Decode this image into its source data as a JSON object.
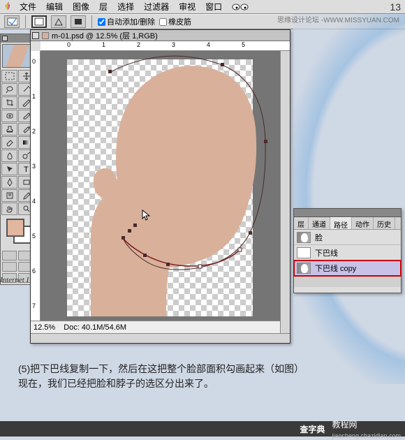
{
  "menu": {
    "items": [
      "文件",
      "编辑",
      "图像",
      "层",
      "选择",
      "过滤器",
      "审视",
      "窗口"
    ],
    "right": "13"
  },
  "watermark": "思缘设计论坛 -WWW.MISSYUAN.COM",
  "optbar": {
    "auto_label": "自动添加/删除",
    "rubber_label": "橡皮筋"
  },
  "toolbox": {
    "tools": [
      "marquee",
      "move",
      "lasso",
      "wand",
      "crop",
      "slice",
      "heal",
      "brush",
      "stamp",
      "history",
      "eraser",
      "gradient",
      "blur",
      "dodge",
      "path",
      "type",
      "pen",
      "shape",
      "notes",
      "eyedrop",
      "hand",
      "zoom"
    ]
  },
  "ie_label": "Internet I",
  "doc": {
    "title": "m-01.psd @ 12.5% (层 1,RGB)",
    "rulerH": [
      "0",
      "1",
      "2",
      "3",
      "4",
      "5"
    ],
    "rulerV": [
      "0",
      "1",
      "2",
      "3",
      "4",
      "5",
      "6",
      "7"
    ],
    "zoom": "12.5%",
    "docinfo": "Doc: 40.1M/54.6M"
  },
  "panel": {
    "tabs": [
      "层",
      "通道",
      "路径",
      "动作",
      "历史"
    ],
    "active_tab": 2,
    "items": [
      {
        "label": "脸"
      },
      {
        "label": "下巴线"
      },
      {
        "label": "下巴线 copy"
      }
    ],
    "selected": 2
  },
  "caption": {
    "line1": "(5)把下巴线复制一下，然后在这把整个脸部面积勾画起来（如图）",
    "line2": "现在，我们已经把脸和脖子的选区分出来了。"
  },
  "footer": {
    "brand": "查字典",
    "brand2": "教程网",
    "sub": "jiaocheng.chazidian.com"
  }
}
